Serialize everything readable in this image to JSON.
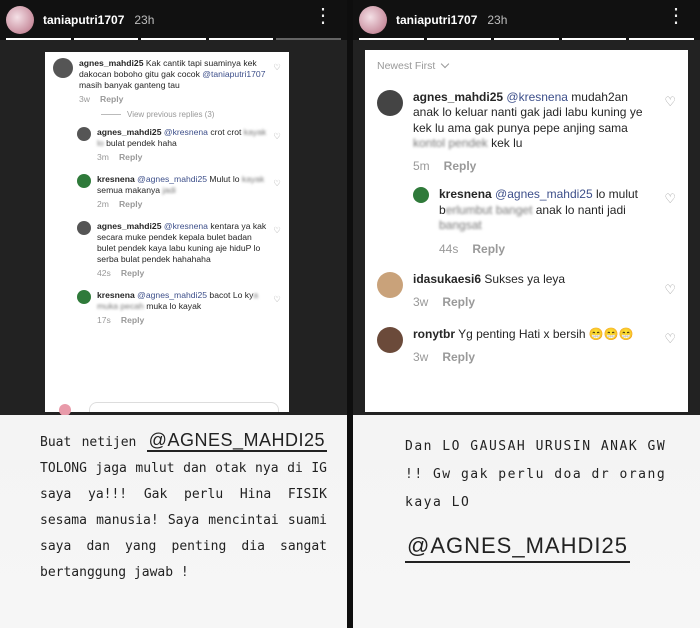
{
  "left_story": {
    "header": {
      "username": "taniaputri1707",
      "time": "23h",
      "more": "⋮"
    },
    "comments": [
      {
        "user": "agnes_mahdi25",
        "text": "Kak cantik tapi suaminya kek dakocan boboho gitu gak cocok ",
        "mention": "@taniaputri1707",
        "text2": " masih banyak ganteng tau",
        "age": "3w",
        "reply": "Reply"
      },
      {
        "user": "agnes_mahdi25",
        "mention": "@kresnena",
        "text": " crot crot ",
        "blurred": "kayak lo",
        "text2": " bulat pendek haha",
        "age": "3m",
        "reply": "Reply"
      },
      {
        "user": "kresnena",
        "mention": "@agnes_mahdi25",
        "text": " Mulut lo ",
        "blurred": "kayak",
        "text2": " semua makanya ",
        "blurred2": "jadi",
        "age": "2m",
        "reply": "Reply"
      },
      {
        "user": "agnes_mahdi25",
        "mention": "@kresnena",
        "text": " kentara ya kak secara muke pendek kepala bulet badan bulet pendek kaya labu kuning aje hiduP lo serba bulat pendek hahahaha",
        "age": "42s",
        "reply": "Reply"
      },
      {
        "user": "kresnena",
        "mention": "@agnes_mahdi25",
        "text": " bacot Lo ky",
        "blurred": "a muka pecah",
        "text2": " muka lo kayak",
        "age": "17s",
        "reply": "Reply"
      }
    ],
    "view_previous": "View previous replies (3)",
    "caption": {
      "line1": "Buat netijen ",
      "handle": "@AGNES_MAHDI25",
      "body": "TOLONG jaga mulut dan otak nya di IG saya ya!!! Gak perlu Hina FISIK sesama manusia! Saya mencintai suami saya dan yang penting dia sangat bertanggung jawab !"
    }
  },
  "right_story": {
    "header": {
      "username": "taniaputri1707",
      "time": "23h",
      "more": "⋮"
    },
    "sort_label": "Newest First",
    "comments": [
      {
        "user": "agnes_mahdi25",
        "mention": "@kresnena",
        "text": " mudah2an anak lo keluar nanti gak jadi labu kuning ye kek lu ama gak punya pepe anjing sama ",
        "blurred": "kontol pendek",
        "text2": " kek lu",
        "age": "5m",
        "reply": "Reply"
      },
      {
        "user": "kresnena",
        "mention": "@agnes_mahdi25",
        "text": " lo mulut b",
        "blurred": "erlumbut banget",
        "text2": " anak lo nanti jadi ",
        "blurred2": "bangsat",
        "age": "44s",
        "reply": "Reply"
      },
      {
        "user": "idasukaesi6",
        "text": "Sukses ya leya",
        "age": "3w",
        "reply": "Reply"
      },
      {
        "user": "ronytbr",
        "text": "Yg penting Hati x bersih 😁😁😁",
        "age": "3w",
        "reply": "Reply"
      }
    ],
    "caption": {
      "body": "Dan LO GAUSAH URUSIN ANAK GW !! Gw gak perlu doa dr orang kaya LO",
      "handle": "@AGNES_MAHDI25"
    }
  },
  "colors": {
    "mention": "#3d4f8a",
    "meta": "#999999",
    "header_bg": "#111111"
  }
}
